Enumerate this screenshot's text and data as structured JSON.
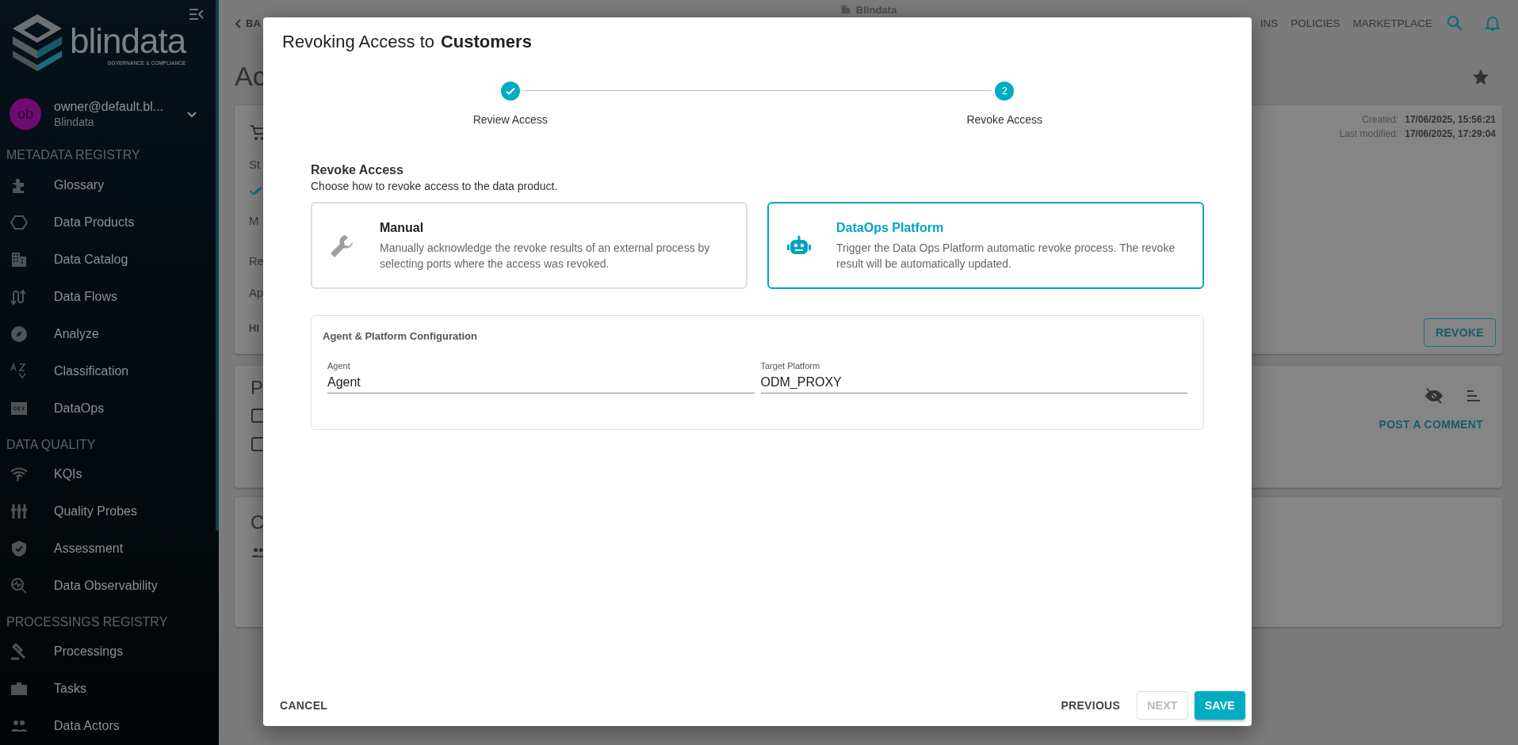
{
  "sidebar": {
    "logo": {
      "name": "blindata",
      "tagline": "GOVERNANCE & COMPLIANCE"
    },
    "user": {
      "initials": "ob",
      "email": "owner@default.bl...",
      "org": "Blindata"
    },
    "sections": [
      {
        "title": "METADATA REGISTRY",
        "items": [
          {
            "label": "Glossary"
          },
          {
            "label": "Data Products"
          },
          {
            "label": "Data Catalog"
          },
          {
            "label": "Data Flows"
          },
          {
            "label": "Analyze"
          },
          {
            "label": "Classification"
          },
          {
            "label": "DataOps"
          }
        ]
      },
      {
        "title": "DATA QUALITY",
        "items": [
          {
            "label": "KQIs"
          },
          {
            "label": "Quality Probes"
          },
          {
            "label": "Assessment"
          },
          {
            "label": "Data Observability"
          }
        ]
      },
      {
        "title": "PROCESSINGS REGISTRY",
        "items": [
          {
            "label": "Processings"
          },
          {
            "label": "Tasks"
          },
          {
            "label": "Data Actors"
          }
        ]
      }
    ]
  },
  "page": {
    "back": "BA",
    "app_title": "Blindata",
    "nav": [
      "INS",
      "POLICIES",
      "MARKETPLACE"
    ],
    "title": "Ac",
    "card1": {
      "lines": [
        "St",
        "M",
        "Re",
        "Ap",
        "HI"
      ],
      "created_label": "Created:",
      "created_value": "17/06/2025, 15:56:21",
      "modified_label": "Last modified:",
      "modified_value": "17/06/2025, 17:29:04",
      "action": "REVOKE"
    },
    "card2": {
      "title": "P",
      "action": "POST A COMMENT"
    },
    "card3": {
      "title": "C"
    }
  },
  "dialog": {
    "title": "Revoking Access to",
    "title_object": "Customers",
    "steps": [
      {
        "label": "Review Access",
        "completed": true
      },
      {
        "label": "Revoke Access",
        "number": "2",
        "completed": false
      }
    ],
    "section_title": "Revoke Access",
    "section_subtitle": "Choose how to revoke access to the data product.",
    "options": [
      {
        "title": "Manual",
        "description": "Manually acknowledge the revoke results of an external process by selecting ports where the access was revoked.",
        "selected": false
      },
      {
        "title": "DataOps Platform",
        "description": "Trigger the Data Ops Platform automatic revoke process. The revoke result will be automatically updated.",
        "selected": true
      }
    ],
    "config": {
      "title": "Agent & Platform Configuration",
      "fields": [
        {
          "label": "Agent",
          "value": "Agent"
        },
        {
          "label": "Target Platform",
          "value": "ODM_PROXY"
        }
      ]
    },
    "buttons": [
      {
        "label": "CANCEL",
        "kind": "text",
        "disabled": false
      },
      {
        "label": "PREVIOUS",
        "kind": "text",
        "disabled": false
      },
      {
        "label": "NEXT",
        "kind": "outlined",
        "disabled": true
      },
      {
        "label": "SAVE",
        "kind": "contained",
        "disabled": false
      }
    ]
  }
}
